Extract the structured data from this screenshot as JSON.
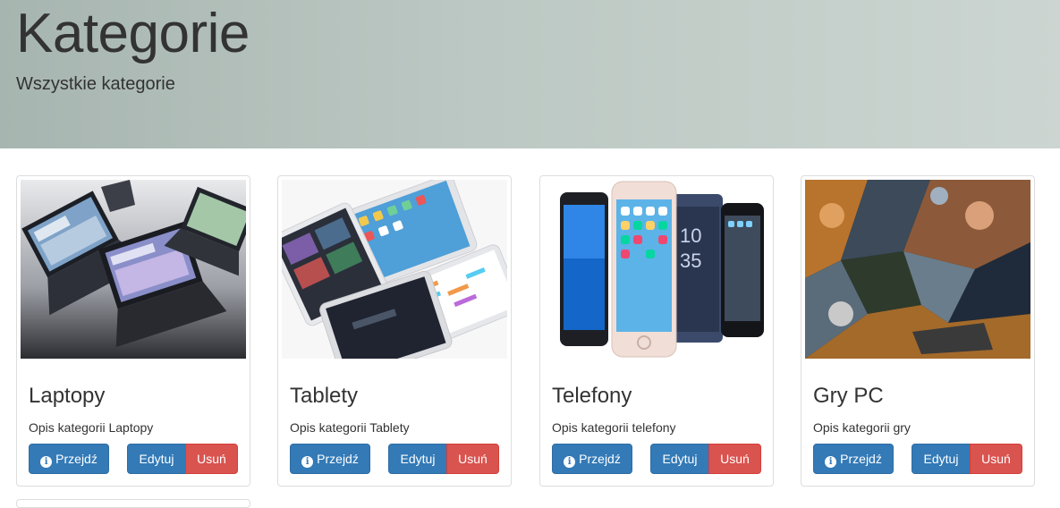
{
  "header": {
    "title": "Kategorie",
    "subtitle": "Wszystkie kategorie"
  },
  "buttons": {
    "go_label": "Przejdź",
    "edit_label": "Edytuj",
    "delete_label": "Usuń",
    "go_icon": "info-circle-icon"
  },
  "categories": [
    {
      "title": "Laptopy",
      "description": "Opis kategorii Laptopy",
      "image": "laptops-image"
    },
    {
      "title": "Tablety",
      "description": "Opis kategorii Tablety",
      "image": "tablets-image"
    },
    {
      "title": "Telefony",
      "description": "Opis kategorii telefony",
      "image": "phones-image"
    },
    {
      "title": "Gry PC",
      "description": "Opis kategorii gry",
      "image": "pc-games-image"
    }
  ],
  "colors": {
    "primary": "#337ab7",
    "danger": "#d9534f",
    "jumbotron": "#c2ccc8"
  }
}
